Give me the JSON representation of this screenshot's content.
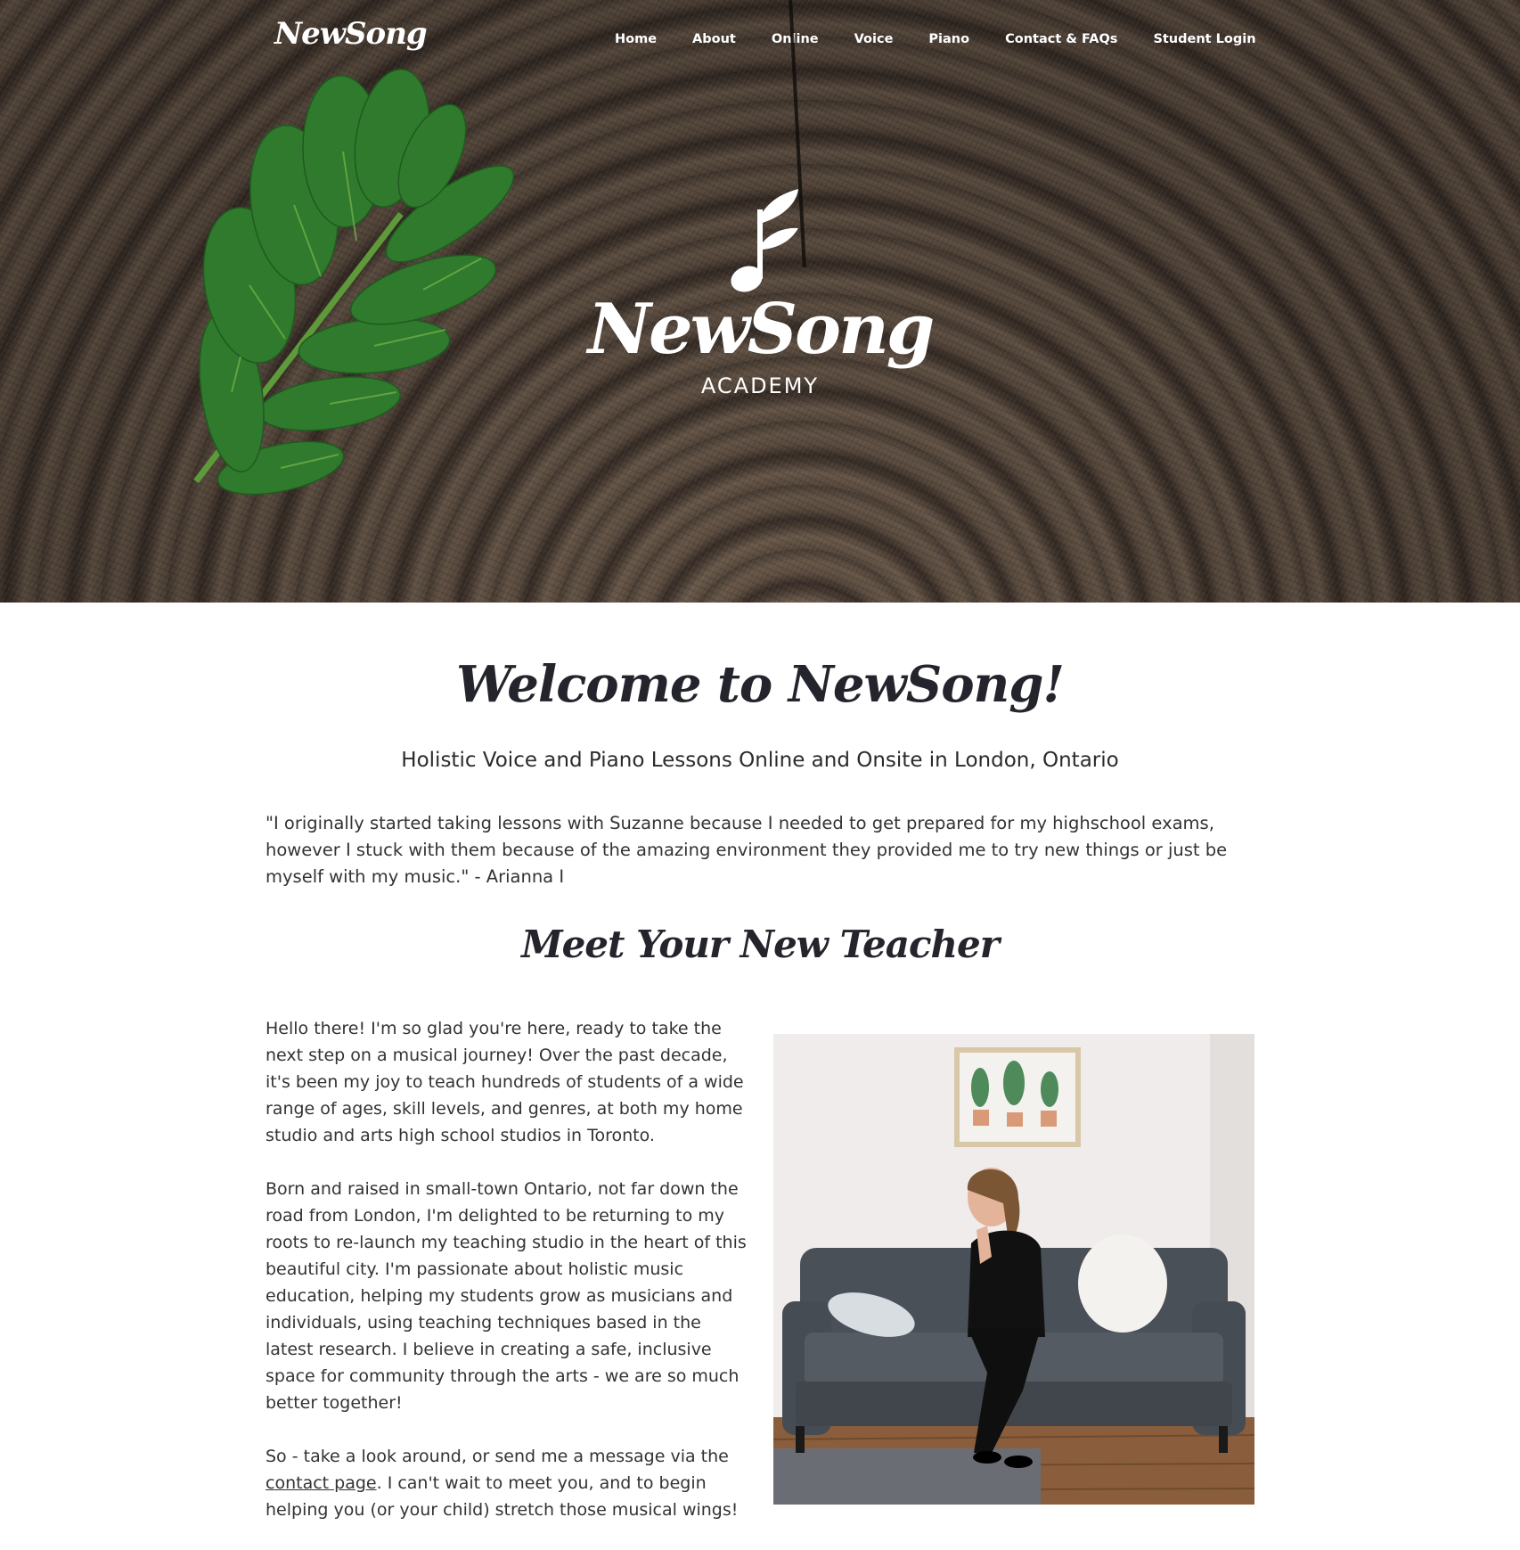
{
  "nav": {
    "logo": "NewSong",
    "items": [
      "Home",
      "About",
      "Online",
      "Voice",
      "Piano",
      "Contact & FAQs",
      "Student Login"
    ]
  },
  "hero": {
    "title": "NewSong",
    "subtitle": "ACADEMY",
    "icons": [
      "leaf-art",
      "music-note-leaf-icon"
    ]
  },
  "main": {
    "welcome": "Welcome to NewSong!",
    "tagline": "Holistic Voice and Piano Lessons Online and Onsite in London, Ontario",
    "quote": "\"I originally started taking lessons with Suzanne because I needed to get prepared for my highschool exams, however I stuck with them because of the amazing environment they provided me to try new things or just be myself with my music.\" - Arianna I",
    "meet_heading": "Meet Your New Teacher",
    "bio": {
      "p1": "Hello there! I'm so glad you're here, ready to take the next step on a musical journey! Over the past decade, it's been my joy to teach hundreds of students of a wide range of ages, skill levels, and genres, at both my home studio and arts high school studios in Toronto.",
      "p2": "Born and raised in small-town Ontario, not far down the road from London, I'm delighted to be returning to my roots to re-launch my teaching studio in the heart of this beautiful city. I'm passionate about holistic music education, helping my students grow as musicians and individuals, using teaching techniques based in the latest research. I believe in creating a safe, inclusive space for community through the arts - we are so much better together!",
      "p3_before": "So - take a look around, or send me a message via the ",
      "p3_link": "contact page",
      "p3_after": ". I can't wait to meet you, and to begin helping you (or your child) stretch those musical wings!"
    }
  },
  "colors": {
    "heading": "#24242c",
    "body_text": "#333333",
    "leaf_green": "#2f7a2c",
    "bark": "#5a4a3d"
  }
}
